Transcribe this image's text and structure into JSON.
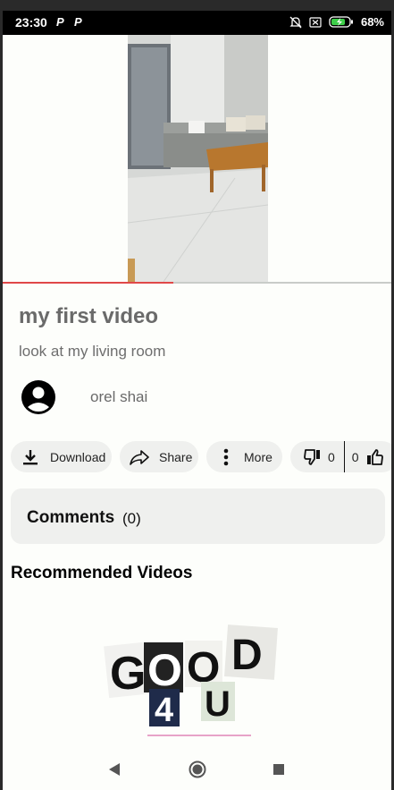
{
  "status_bar": {
    "time": "23:30",
    "notif_1": "P",
    "notif_2": "P",
    "battery": "68%"
  },
  "video": {
    "progress_fraction": 0.44
  },
  "title": "my first video",
  "description": "look at my living room",
  "author": {
    "name": "orel shai"
  },
  "actions": {
    "download_label": "Download",
    "share_label": "Share",
    "more_label": "More",
    "dislike_count": "0",
    "like_count": "0"
  },
  "comments": {
    "label": "Comments",
    "count": "(0)"
  },
  "recommended": {
    "title": "Recommended Videos",
    "thumbnail_text": [
      "G",
      "O",
      "O",
      "D",
      "4",
      "U"
    ]
  },
  "colors": {
    "accent": "#e04848",
    "chip_bg": "#eff0ee",
    "page_bg": "#fdfefb"
  }
}
